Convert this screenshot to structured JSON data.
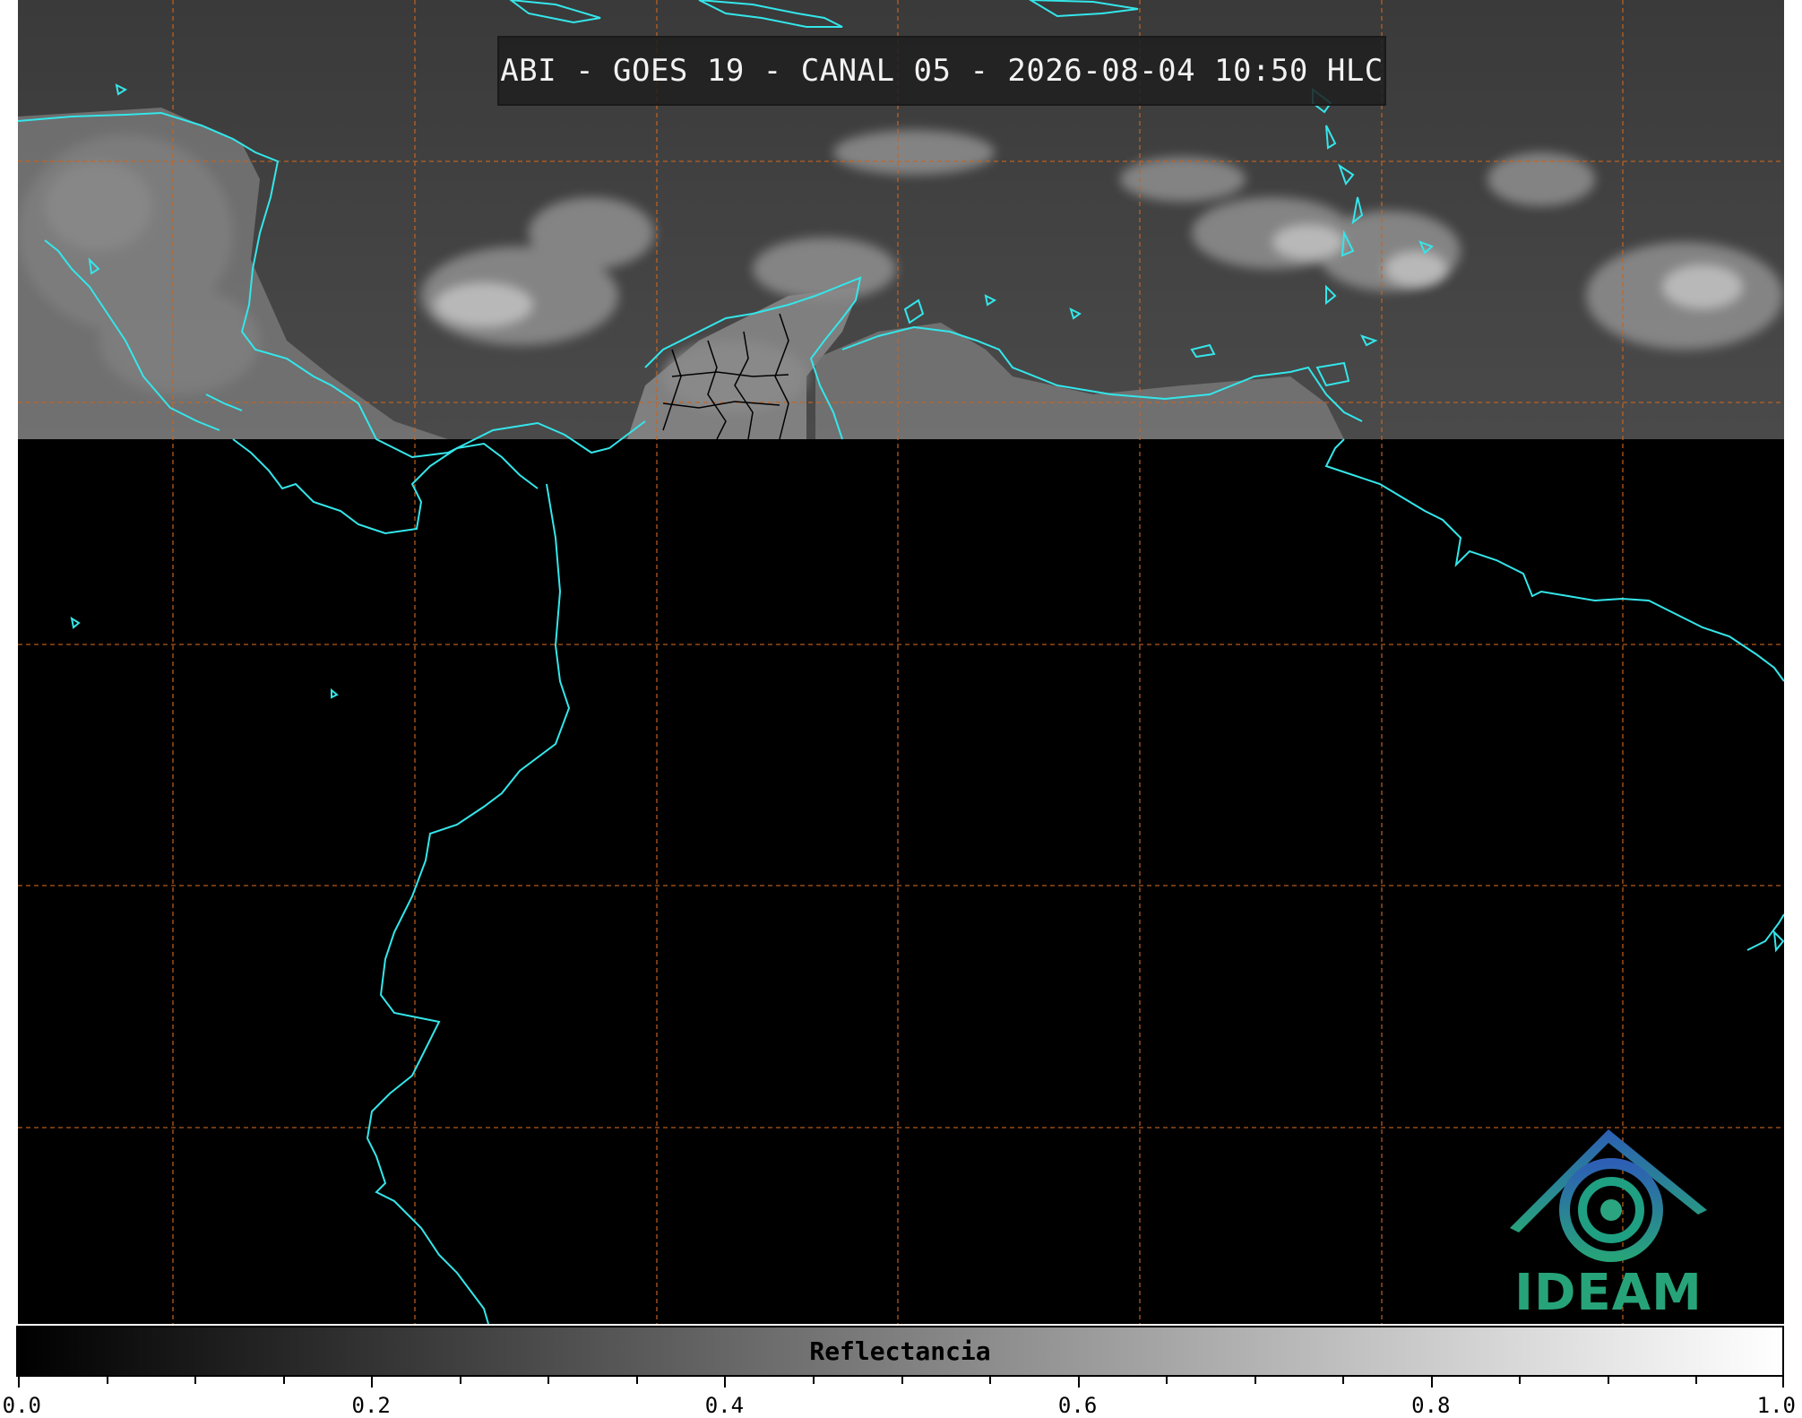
{
  "title": "ABI - GOES 19 - CANAL 05 - 2026-08-04 10:50 HLC",
  "logo": {
    "text": "IDEAM",
    "icon": "ideam-logo-icon",
    "color": "#27a37a"
  },
  "colorbar": {
    "label": "Reflectancia",
    "min": 0.0,
    "max": 1.0,
    "colormap": "grayscale",
    "ticks": [
      "0.0",
      "0.2",
      "0.4",
      "0.6",
      "0.8",
      "1.0"
    ],
    "minor_tick_step": 0.05
  },
  "map": {
    "background": "#000000",
    "coastline_color": "#34e6ea",
    "grid_color": "#c8641e",
    "grid_style": "dashed",
    "border_color": "#000000",
    "imagery_region": "top band (clouds over Caribbean)"
  }
}
